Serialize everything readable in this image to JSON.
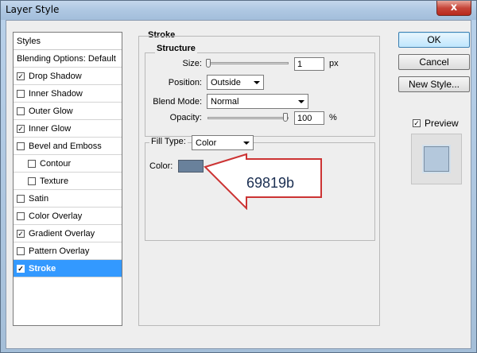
{
  "window": {
    "title": "Layer Style",
    "close_glyph": "x"
  },
  "styles_list": {
    "header": "Styles",
    "blending_options": "Blending Options: Default",
    "items": [
      {
        "label": "Drop Shadow",
        "checked": true,
        "indent": false,
        "selected": false
      },
      {
        "label": "Inner Shadow",
        "checked": false,
        "indent": false,
        "selected": false
      },
      {
        "label": "Outer Glow",
        "checked": false,
        "indent": false,
        "selected": false
      },
      {
        "label": "Inner Glow",
        "checked": true,
        "indent": false,
        "selected": false
      },
      {
        "label": "Bevel and Emboss",
        "checked": false,
        "indent": false,
        "selected": false
      },
      {
        "label": "Contour",
        "checked": false,
        "indent": true,
        "selected": false
      },
      {
        "label": "Texture",
        "checked": false,
        "indent": true,
        "selected": false
      },
      {
        "label": "Satin",
        "checked": false,
        "indent": false,
        "selected": false
      },
      {
        "label": "Color Overlay",
        "checked": false,
        "indent": false,
        "selected": false
      },
      {
        "label": "Gradient Overlay",
        "checked": true,
        "indent": false,
        "selected": false
      },
      {
        "label": "Pattern Overlay",
        "checked": false,
        "indent": false,
        "selected": false
      },
      {
        "label": "Stroke",
        "checked": true,
        "indent": false,
        "selected": true
      }
    ]
  },
  "stroke": {
    "section_title": "Stroke",
    "structure_title": "Structure",
    "size_label": "Size:",
    "size_value": "1",
    "size_unit": "px",
    "size_slider_fraction": 0.01,
    "position_label": "Position:",
    "position_value": "Outside",
    "blend_mode_label": "Blend Mode:",
    "blend_mode_value": "Normal",
    "opacity_label": "Opacity:",
    "opacity_value": "100",
    "opacity_unit": "%",
    "opacity_slider_fraction": 1.0,
    "fill_type_label": "Fill Type:",
    "fill_type_value": "Color",
    "color_label": "Color:",
    "color_hex": "#69819b"
  },
  "callout": {
    "text": "69819b",
    "fill": "#ffffff",
    "border": "#cc3333"
  },
  "buttons": {
    "ok": "OK",
    "cancel": "Cancel",
    "new_style": "New Style...",
    "preview_label": "Preview",
    "preview_checked": true
  }
}
